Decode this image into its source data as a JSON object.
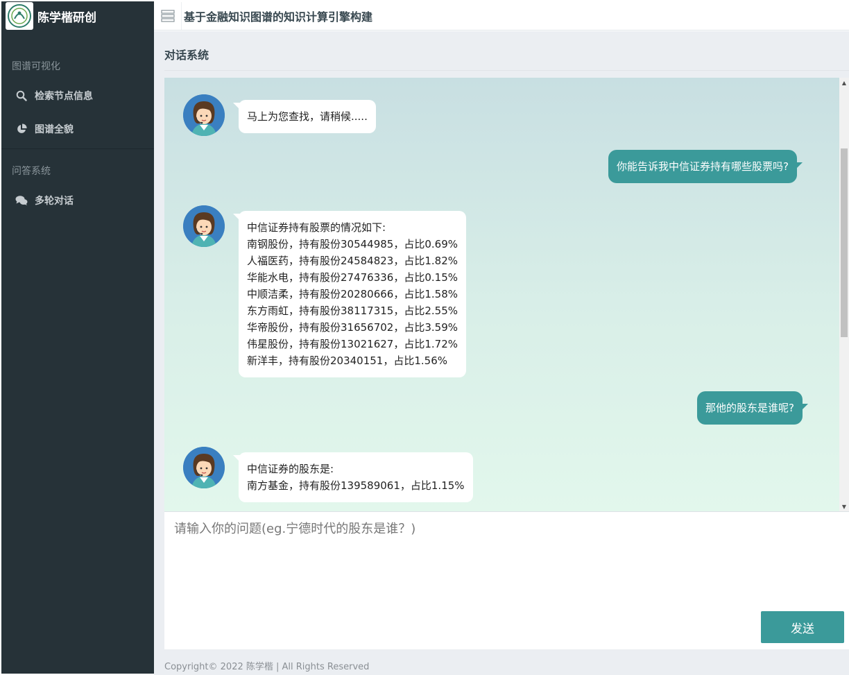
{
  "sidebar": {
    "brand_name": "陈学楷研创",
    "sections": [
      {
        "title": "图谱可视化",
        "items": [
          {
            "label": "检索节点信息",
            "icon": "search-icon"
          },
          {
            "label": "图谱全貌",
            "icon": "pie-chart-icon"
          }
        ]
      },
      {
        "title": "问答系统",
        "items": [
          {
            "label": "多轮对话",
            "icon": "chat-icon"
          }
        ]
      }
    ]
  },
  "header": {
    "title": "基于金融知识图谱的知识计算引擎构建",
    "menu_icon": "hamburger-menu-icon"
  },
  "main": {
    "page_title": "对话系统"
  },
  "chat": {
    "messages": [
      {
        "role": "bot",
        "lines": [
          "马上为您查找，请稍候....."
        ]
      },
      {
        "role": "user",
        "lines": [
          "你能告诉我中信证券持有哪些股票吗?"
        ]
      },
      {
        "role": "bot",
        "lines": [
          "中信证券持有股票的情况如下:",
          "南钢股份，持有股份30544985，占比0.69%",
          "人福医药，持有股份24584823，占比1.82%",
          "华能水电，持有股份27476336，占比0.15%",
          "中顺洁柔，持有股份20280666，占比1.58%",
          "东方雨虹，持有股份38117315，占比2.55%",
          "华帝股份，持有股份31656702，占比3.59%",
          "伟星股份，持有股份13021627，占比1.72%",
          "新洋丰，持有股份20340151，占比1.56%"
        ]
      },
      {
        "role": "user",
        "lines": [
          "那他的股东是谁呢?"
        ]
      },
      {
        "role": "bot",
        "lines": [
          "中信证券的股东是:",
          "南方基金，持有股份139589061，占比1.15%"
        ]
      }
    ]
  },
  "input": {
    "placeholder": "请输入你的问题(eg.宁德时代的股东是谁？)",
    "value": "",
    "send_label": "发送"
  },
  "footer": {
    "text": "Copyright© 2022 陈学楷   |   All Rights Reserved"
  },
  "colors": {
    "sidebar_bg": "#263238",
    "accent": "#3b9a9a",
    "content_bg": "#ebeef2"
  }
}
